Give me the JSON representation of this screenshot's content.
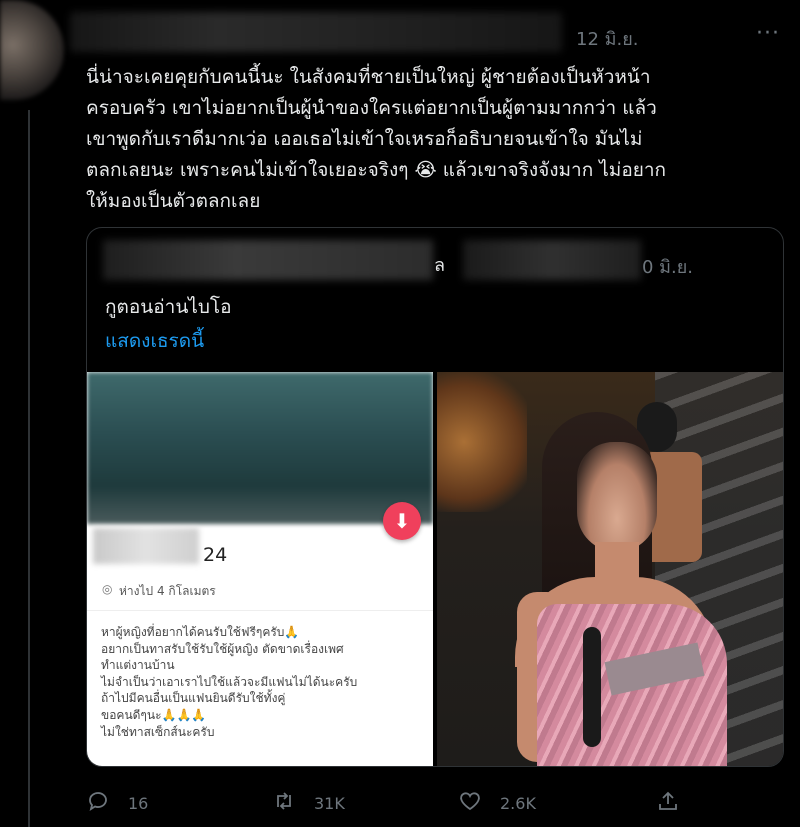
{
  "tweet": {
    "date": "12 มิ.ย.",
    "more": "···",
    "text_lines": [
      "นี่น่าจะเคยคุยกับคนนี้นะ ในสังคมที่ชายเป็นใหญ่ ผู้ชายต้องเป็นหัวหน้า",
      "ครอบครัว เขาไม่อยากเป็นผู้นำของใครแต่อยากเป็นผู้ตามมากกว่า แล้ว",
      "เขาพูดกับเราดีมากเว่อ เออเธอไม่เข้าใจเหรอก็อธิบายจนเข้าใจ มันไม่",
      "ตลกเลยนะ เพราะคนไม่เข้าใจเยอะจริงๆ 😭 แล้วเขาจริงจังมาก ไม่อยาก",
      "ให้มองเป็นตัวตลกเลย"
    ]
  },
  "quote": {
    "name_tail": "ล",
    "date": "0 มิ.ย.",
    "text": "กูตอนอ่านไบโอ",
    "show_thread": "แสดงเธรดนี้",
    "profile_card": {
      "age": "24",
      "distance": "ห่างไป 4 กิโลเมตร",
      "bio_lines": [
        "หาผู้หญิงที่อยากได้คนรับใช้ฟรีๆครับ🙏",
        "อยากเป็นทาสรับใช้รับใช้ผู้หญิง ตัดขาดเรื่องเพศ",
        "ทำแต่งานบ้าน",
        "ไม่จำเป็นว่าเอาเราไปใช้แล้วจะมีแฟนไม่ได้นะครับ",
        "ถ้าไปมีคนอื่นเป็นแฟนยินดีรับใช้ทั้งคู่",
        "ขอคนดีๆนะ🙏🙏🙏",
        "ไม่ใช่ทาสเซ็กส์นะครับ"
      ]
    }
  },
  "actions": {
    "reply_count": "16",
    "retweet_count": "31K",
    "like_count": "2.6K"
  },
  "icons": {
    "reply": "reply-icon",
    "retweet": "retweet-icon",
    "like": "heart-icon",
    "share": "share-icon",
    "download": "download-icon",
    "location": "location-pin-icon"
  },
  "colors": {
    "background": "#000000",
    "text": "#e7e9ea",
    "muted": "#6e767d",
    "link": "#1d9bf0",
    "border": "#2f3336",
    "download_button": "#f0405c"
  }
}
